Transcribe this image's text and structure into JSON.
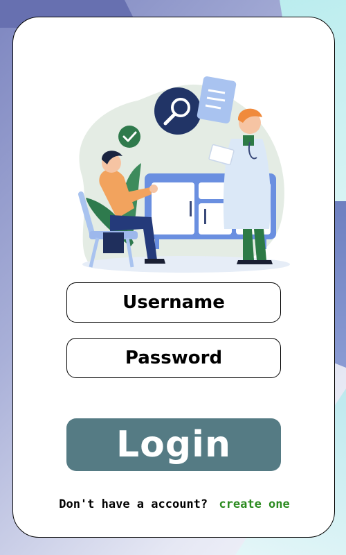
{
  "form": {
    "username_placeholder": "Username",
    "password_placeholder": "Password",
    "login_label": "Login"
  },
  "signup": {
    "prompt": "Don't have a account?",
    "link_label": "create one"
  },
  "colors": {
    "login_button": "#557b84",
    "link": "#2a8a1e",
    "card_background": "#ffffff"
  },
  "illustration": {
    "icons": [
      "magnifier-icon",
      "checkmark-icon",
      "document-icon"
    ],
    "description_name": "doctor-patient-illustration"
  }
}
